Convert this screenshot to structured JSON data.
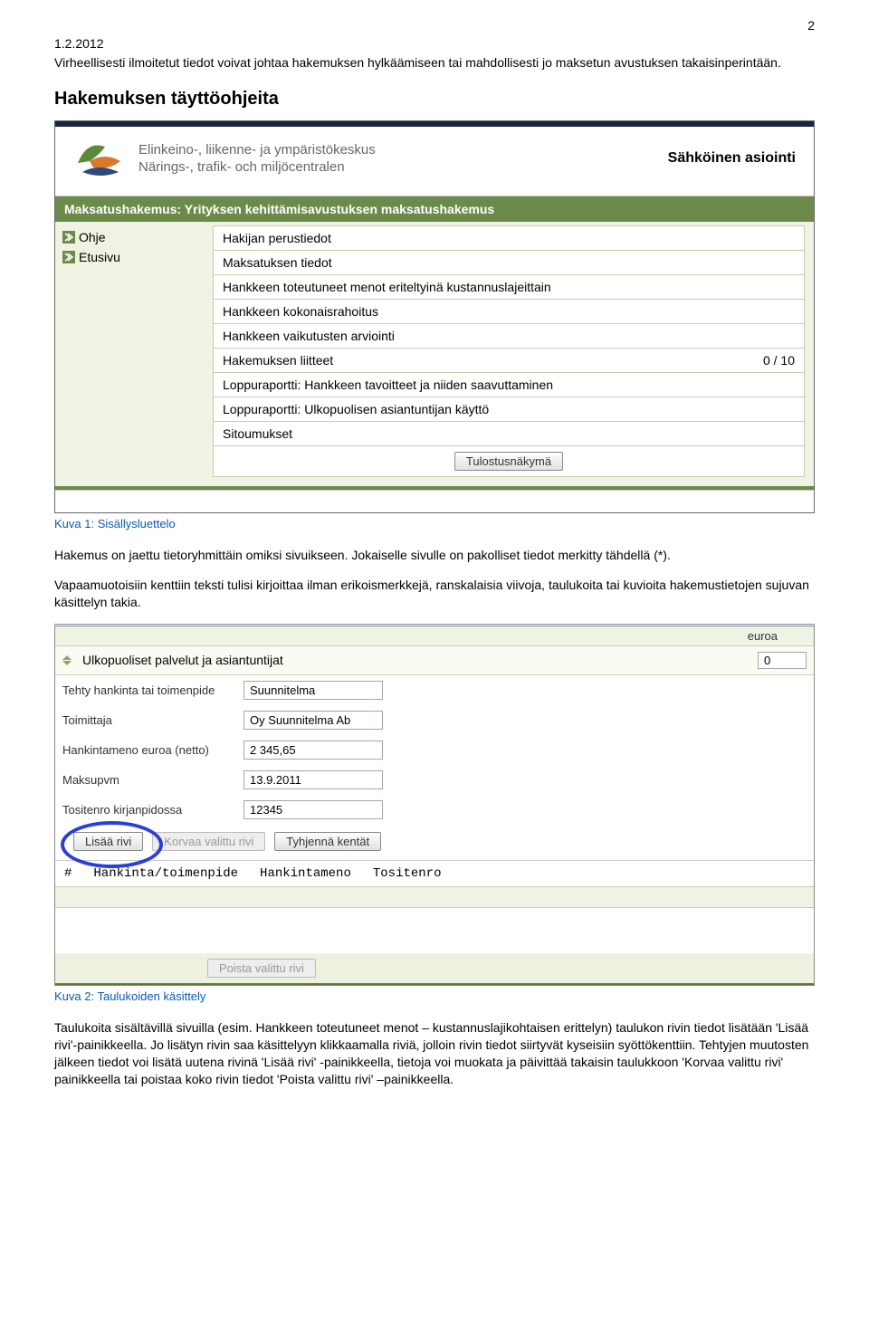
{
  "meta": {
    "date": "1.2.2012",
    "page_top": "2"
  },
  "intro": "Virheellisesti ilmoitetut tiedot voivat johtaa hakemuksen hylkäämiseen tai mahdollisesti jo maksetun avustuksen takaisinperintään.",
  "heading1": "Hakemuksen täyttöohjeita",
  "shot1": {
    "org_line1": "Elinkeino-, liikenne- ja ympäristökeskus",
    "org_line2": "Närings-, trafik- och miljöcentralen",
    "header_right": "Sähköinen asiointi",
    "titlebar": "Maksatushakemus: Yrityksen kehittämisavustuksen maksatushakemus",
    "side": {
      "ohje": "Ohje",
      "etusivu": "Etusivu"
    },
    "toc": [
      "Hakijan perustiedot",
      "Maksatuksen tiedot",
      "Hankkeen toteutuneet menot eriteltyinä kustannuslajeittain",
      "Hankkeen kokonaisrahoitus",
      "Hankkeen vaikutusten arviointi",
      "Hakemuksen liitteet",
      "Loppuraportti: Hankkeen tavoitteet ja niiden saavuttaminen",
      "Loppuraportti: Ulkopuolisen asiantuntijan käyttö",
      "Sitoumukset"
    ],
    "attach_count": "0 / 10",
    "print_btn": "Tulostusnäkymä"
  },
  "caption1": "Kuva 1: Sisällysluettelo",
  "para1": "Hakemus on jaettu tietoryhmittäin omiksi sivuikseen. Jokaiselle sivulle on pakolliset tiedot merkitty tähdellä (*).",
  "para2": "Vapaamuotoisiin kenttiin teksti tulisi kirjoittaa ilman erikoismerkkejä, ranskalaisia viivoja, taulukoita tai kuvioita hakemustietojen sujuvan käsittelyn takia.",
  "shot2": {
    "euroa": "euroa",
    "section": "Ulkopuoliset palvelut ja asiantuntijat",
    "zero": "0",
    "rows": {
      "r1": {
        "lbl": "Tehty hankinta tai toimenpide",
        "val": "Suunnitelma"
      },
      "r2": {
        "lbl": "Toimittaja",
        "val": "Oy Suunnitelma Ab"
      },
      "r3": {
        "lbl": "Hankintameno euroa (netto)",
        "val": "2 345,65"
      },
      "r4": {
        "lbl": "Maksupvm",
        "val": "13.9.2011"
      },
      "r5": {
        "lbl": "Tositenro kirjanpidossa",
        "val": "12345"
      }
    },
    "btn_add": "Lisää rivi",
    "btn_replace": "Korvaa valittu rivi",
    "btn_clear": "Tyhjennä kentät",
    "cols": {
      "hash": "#",
      "c1": "Hankinta/toimenpide",
      "c2": "Hankintameno",
      "c3": "Tositenro"
    },
    "btn_del": "Poista valittu rivi"
  },
  "caption2": "Kuva 2: Taulukoiden käsittely",
  "para3": "Taulukoita sisältävillä sivuilla (esim. Hankkeen toteutuneet menot – kustannuslajikohtaisen erittelyn) taulukon rivin tiedot lisätään 'Lisää rivi'-painikkeella. Jo lisätyn rivin saa käsittelyyn klikkaamalla riviä, jolloin rivin tiedot siirtyvät kyseisiin syöttökenttiin. Tehtyjen muutosten jälkeen tiedot voi lisätä uutena rivinä 'Lisää rivi' -painikkeella, tietoja voi muokata ja päivittää takaisin taulukkoon 'Korvaa valittu rivi' painikkeella tai poistaa koko rivin tiedot 'Poista valittu rivi' –painikkeella."
}
